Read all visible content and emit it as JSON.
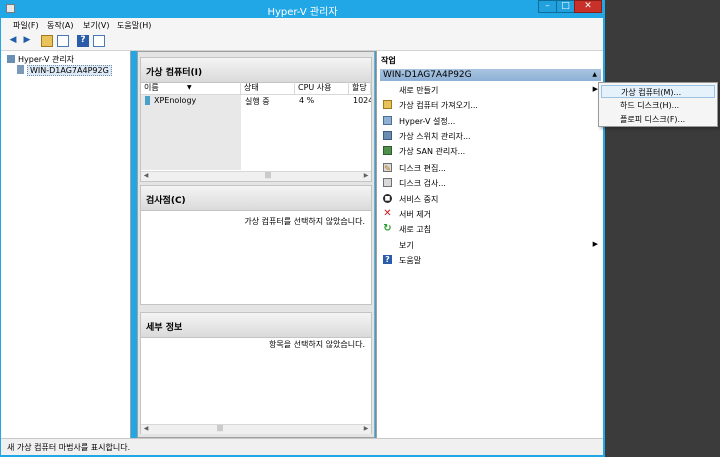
{
  "window": {
    "title": "Hyper-V 관리자",
    "minimize": "–",
    "maximize": "□",
    "close": "✕"
  },
  "menubar": [
    "파일(F)",
    "동작(A)",
    "보기(V)",
    "도움말(H)"
  ],
  "tree": {
    "root": "Hyper-V 관리자",
    "server": "WIN-D1AG7A4P92G"
  },
  "vm_section": {
    "title": "가상 컴퓨터(I)",
    "columns": [
      "이름",
      "상태",
      "CPU 사용",
      "할당"
    ],
    "rows": [
      {
        "name": "XPEnology",
        "state": "실행 중",
        "cpu": "4 %",
        "memory": "1024M"
      }
    ]
  },
  "checkpoint_section": {
    "title": "검사점(C)",
    "message": "가상 컴퓨터를 선택하지 않았습니다."
  },
  "details_section": {
    "title": "세부 정보",
    "message": "항목을 선택하지 않았습니다."
  },
  "actions": {
    "header": "작업",
    "group": "WIN-D1AG7A4P92G",
    "items": [
      {
        "label": "새로 만들기",
        "icon": "blank",
        "submenu": true
      },
      {
        "label": "가상 컴퓨터 가져오기...",
        "icon": "import-icon"
      },
      {
        "label": "Hyper-V 설정...",
        "icon": "settings-icon"
      },
      {
        "label": "가상 스위치 관리자...",
        "icon": "switch-icon"
      },
      {
        "label": "가상 SAN 관리자...",
        "icon": "san-icon"
      },
      {
        "label": "디스크 편집...",
        "icon": "edit-disk-icon"
      },
      {
        "label": "디스크 검사...",
        "icon": "inspect-disk-icon"
      },
      {
        "label": "서비스 중지",
        "icon": "stop-icon"
      },
      {
        "label": "서버 제거",
        "icon": "remove-icon"
      },
      {
        "label": "새로 고침",
        "icon": "refresh-icon"
      },
      {
        "label": "보기",
        "icon": "blank",
        "submenu": true
      },
      {
        "label": "도움말",
        "icon": "help-icon"
      }
    ]
  },
  "submenu": [
    "가상 컴퓨터(M)...",
    "하드 디스크(H)...",
    "플로피 디스크(F)..."
  ],
  "status": "새 가상 컴퓨터 마법사를 표시합니다.",
  "colors": {
    "title_bar": "#22a7e6",
    "group_header": "#99bbdd",
    "close_button": "#c7312a",
    "desktop": "#3b3b3b"
  }
}
